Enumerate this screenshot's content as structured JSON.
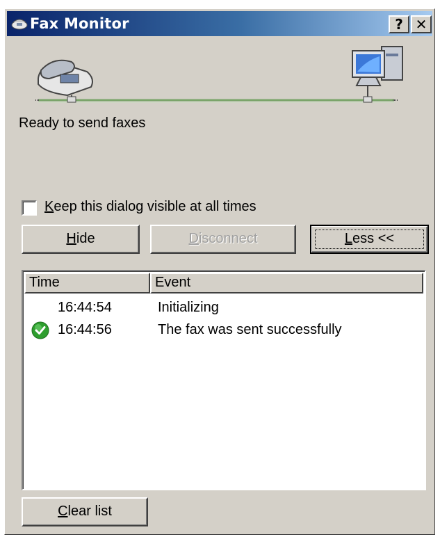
{
  "window": {
    "title": "Fax Monitor",
    "title_icon": "fax-icon",
    "help_glyph": "?",
    "close_glyph": "✕"
  },
  "status_text": "Ready to send faxes",
  "keep_visible": {
    "mnemonic": "K",
    "rest": "eep this dialog visible at all times",
    "checked": false
  },
  "buttons": {
    "hide": {
      "mnemonic": "H",
      "rest": "ide",
      "enabled": true
    },
    "disconnect": {
      "mnemonic": "D",
      "rest": "isconnect",
      "enabled": false
    },
    "less": {
      "mnemonic": "L",
      "rest": "ess <<",
      "focused": true
    },
    "clear": {
      "mnemonic": "C",
      "rest": "lear list"
    }
  },
  "event_list": {
    "columns": [
      "Time",
      "Event"
    ],
    "rows": [
      {
        "time": "16:44:54",
        "event": "Initializing",
        "icon": null
      },
      {
        "time": "16:44:56",
        "event": "The fax was sent successfully",
        "icon": "success-check-icon"
      }
    ]
  },
  "colors": {
    "title_gradient_start": "#0a246a",
    "title_gradient_end": "#a6caf0",
    "dialog_face": "#d4d0c8",
    "success_green": "#2e9e2e",
    "line_green": "#8fbf7f"
  }
}
